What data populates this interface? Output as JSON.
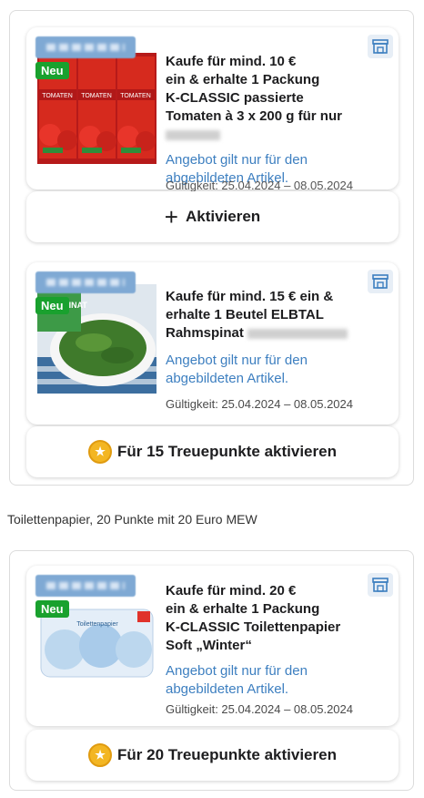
{
  "offers": [
    {
      "badge": "Neu",
      "title": "Kaufe für mind. 10 €\nein & erhalte 1 Packung\nK-CLASSIC passierte\nTomaten à 3 x 200 g für nur",
      "link": "Angebot gilt nur für den\nabgebildeten Artikel.",
      "validity": "Gültigkeit: 25.04.2024 – 08.05.2024",
      "action": "Aktivieren",
      "image_label": "TOMATEN"
    },
    {
      "badge": "Neu",
      "title": "Kaufe für mind. 15 € ein &\nerhalte 1 Beutel ELBTAL\nRahmspinat",
      "link": "Angebot gilt nur für den\nabgebildeten Artikel.",
      "validity": "Gültigkeit: 25.04.2024 – 08.05.2024",
      "action": "Für 15 Treuepunkte aktivieren",
      "image_label": "RAHM SPINAT"
    },
    {
      "badge": "Neu",
      "title": "Kaufe für mind. 20 €\nein & erhalte 1 Packung\nK-CLASSIC Toilettenpapier\nSoft „Winter“",
      "link": "Angebot gilt nur für den\nabgebildeten Artikel.",
      "validity": "Gültigkeit: 25.04.2024 – 08.05.2024",
      "action": "Für 20 Treuepunkte aktivieren",
      "image_label": "Toilettenpapier"
    }
  ],
  "caption": "Toilettenpapier, 20 Punkte mit 20 Euro MEW",
  "colors": {
    "accent_blue": "#3d7fc0",
    "badge_green": "#19a12e",
    "coin": "#f3b623"
  }
}
